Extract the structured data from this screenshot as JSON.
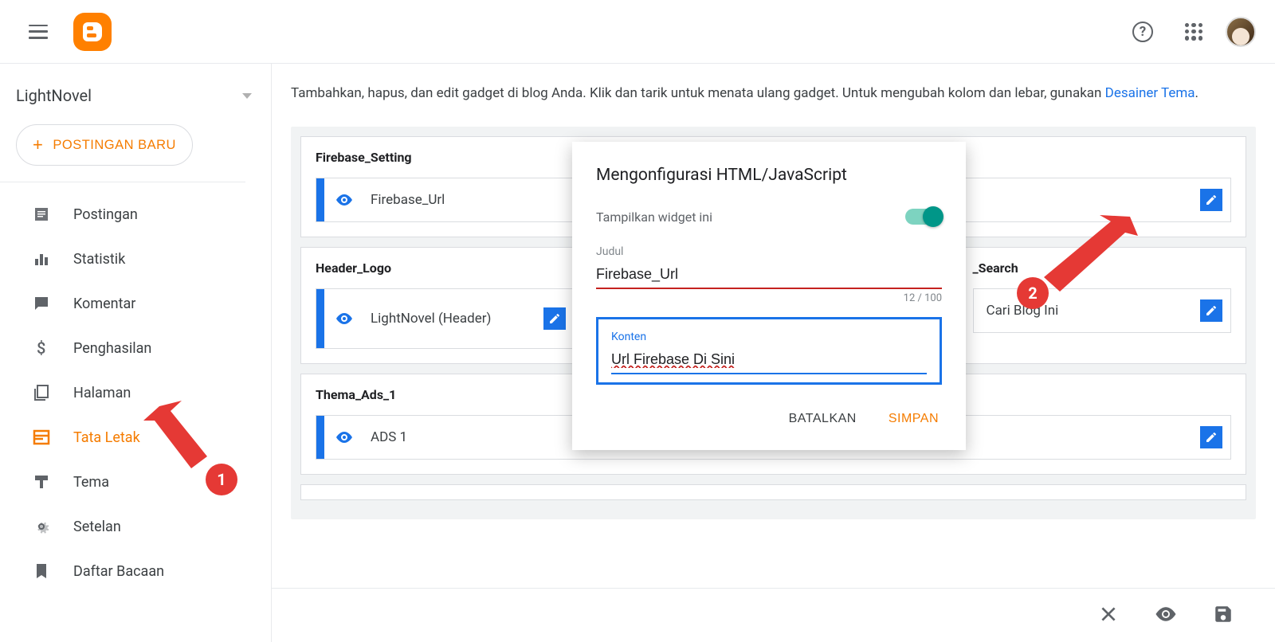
{
  "header": {
    "blog_name": "LightNovel",
    "new_post_label": "POSTINGAN BARU"
  },
  "nav": {
    "items": [
      {
        "label": "Postingan"
      },
      {
        "label": "Statistik"
      },
      {
        "label": "Komentar"
      },
      {
        "label": "Penghasilan"
      },
      {
        "label": "Halaman"
      },
      {
        "label": "Tata Letak"
      },
      {
        "label": "Tema"
      },
      {
        "label": "Setelan"
      },
      {
        "label": "Daftar Bacaan"
      }
    ]
  },
  "main": {
    "intro_text": "Tambahkan, hapus, dan edit gadget di blog Anda. Klik dan tarik untuk menata ulang gadget. Untuk mengubah kolom dan lebar, gunakan ",
    "intro_link": "Desainer Tema",
    "sections": [
      {
        "title": "Firebase_Setting",
        "gadgets": [
          {
            "label": "Firebase_Url"
          }
        ]
      },
      {
        "title": "Header_Logo",
        "title2": "_Search",
        "gadgets": [
          {
            "label": "LightNovel (Header)"
          },
          {
            "label": "Cari Blog Ini"
          }
        ]
      },
      {
        "title": "Thema_Ads_1",
        "gadgets": [
          {
            "label": "ADS 1"
          }
        ]
      }
    ]
  },
  "dialog": {
    "title": "Mengonfigurasi HTML/JavaScript",
    "show_widget_label": "Tampilkan widget ini",
    "title_field_label": "Judul",
    "title_field_value": "Firebase_Url",
    "char_count": "12 / 100",
    "content_field_label": "Konten",
    "content_field_value": "Url Firebase Di Sini",
    "cancel_label": "BATALKAN",
    "save_label": "SIMPAN"
  },
  "annotations": {
    "badge1": "1",
    "badge2": "2"
  }
}
